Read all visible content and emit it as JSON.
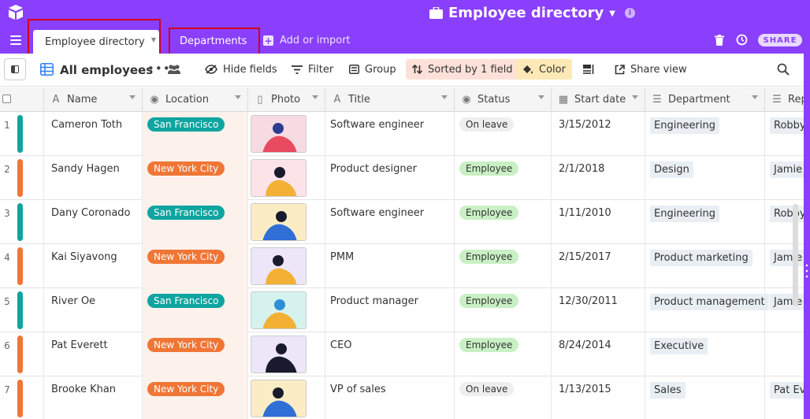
{
  "header": {
    "base_title": "Employee directory",
    "share_label": "SHARE"
  },
  "tabs": {
    "active": "Employee directory",
    "second": "Departments",
    "add_import": "Add or import"
  },
  "toolbar": {
    "view_name": "All employees",
    "hide_fields": "Hide fields",
    "filter": "Filter",
    "group": "Group",
    "sorted": "Sorted by 1 field",
    "color": "Color",
    "share_view": "Share view"
  },
  "columns": [
    "Name",
    "Location",
    "Photo",
    "Title",
    "Status",
    "Start date",
    "Department",
    "Rep"
  ],
  "rows": [
    {
      "num": "1",
      "name": "Cameron Toth",
      "location": "San Francisco",
      "title": "Software engineer",
      "status": "On leave",
      "start": "3/15/2012",
      "department": "Engineering",
      "rep": "Robby"
    },
    {
      "num": "2",
      "name": "Sandy Hagen",
      "location": "New York City",
      "title": "Product designer",
      "status": "Employee",
      "start": "2/1/2018",
      "department": "Design",
      "rep": "Jamie Z"
    },
    {
      "num": "3",
      "name": "Dany Coronado",
      "location": "San Francisco",
      "title": "Software engineer",
      "status": "Employee",
      "start": "1/11/2010",
      "department": "Engineering",
      "rep": "Robby"
    },
    {
      "num": "4",
      "name": "Kai Siyavong",
      "location": "New York City",
      "title": "PMM",
      "status": "Employee",
      "start": "2/15/2017",
      "department": "Product marketing",
      "rep": "Jamie Z"
    },
    {
      "num": "5",
      "name": "River Oe",
      "location": "San Francisco",
      "title": "Product manager",
      "status": "Employee",
      "start": "12/30/2011",
      "department": "Product management",
      "rep": "Jamie Z"
    },
    {
      "num": "6",
      "name": "Pat Everett",
      "location": "New York City",
      "title": "CEO",
      "status": "Employee",
      "start": "8/24/2014",
      "department": "Executive",
      "rep": ""
    },
    {
      "num": "7",
      "name": "Brooke Khan",
      "location": "New York City",
      "title": "VP of sales",
      "status": "On leave",
      "start": "1/13/2015",
      "department": "Sales",
      "rep": "Pat Eve"
    }
  ],
  "colors": {
    "brand_purple": "#8a3ffc",
    "sf_pill": "#0ea5a0",
    "nyc_pill": "#f07636",
    "employee_pill": "#c9f0c4",
    "on_leave_pill": "#eeeeee",
    "highlight_red": "#d0021b"
  }
}
